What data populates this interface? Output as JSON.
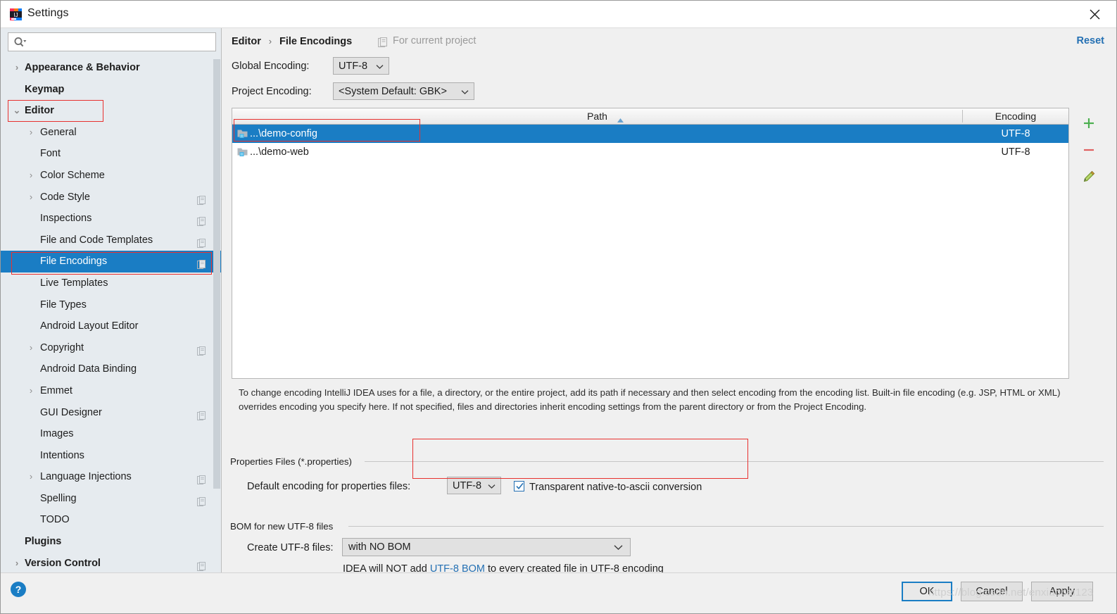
{
  "window": {
    "title": "Settings",
    "app_icon": "intellij-idea-icon",
    "close_icon": "close-icon"
  },
  "sidebar": {
    "search": {
      "placeholder": "",
      "value": "",
      "icon": "search-icon"
    },
    "items": [
      {
        "label": "Appearance & Behavior",
        "level": 0,
        "bold": true,
        "arrow": "›",
        "badge": false,
        "selected": false
      },
      {
        "label": "Keymap",
        "level": 0,
        "bold": true,
        "arrow": "",
        "badge": false,
        "selected": false
      },
      {
        "label": "Editor",
        "level": 0,
        "bold": true,
        "arrow": "⌄",
        "badge": false,
        "selected": false
      },
      {
        "label": "General",
        "level": 1,
        "bold": false,
        "arrow": "›",
        "badge": false,
        "selected": false
      },
      {
        "label": "Font",
        "level": 1,
        "bold": false,
        "arrow": "",
        "badge": false,
        "selected": false
      },
      {
        "label": "Color Scheme",
        "level": 1,
        "bold": false,
        "arrow": "›",
        "badge": false,
        "selected": false
      },
      {
        "label": "Code Style",
        "level": 1,
        "bold": false,
        "arrow": "›",
        "badge": true,
        "selected": false
      },
      {
        "label": "Inspections",
        "level": 1,
        "bold": false,
        "arrow": "",
        "badge": true,
        "selected": false
      },
      {
        "label": "File and Code Templates",
        "level": 1,
        "bold": false,
        "arrow": "",
        "badge": true,
        "selected": false
      },
      {
        "label": "File Encodings",
        "level": 1,
        "bold": false,
        "arrow": "",
        "badge": true,
        "selected": true
      },
      {
        "label": "Live Templates",
        "level": 1,
        "bold": false,
        "arrow": "",
        "badge": false,
        "selected": false
      },
      {
        "label": "File Types",
        "level": 1,
        "bold": false,
        "arrow": "",
        "badge": false,
        "selected": false
      },
      {
        "label": "Android Layout Editor",
        "level": 1,
        "bold": false,
        "arrow": "",
        "badge": false,
        "selected": false
      },
      {
        "label": "Copyright",
        "level": 1,
        "bold": false,
        "arrow": "›",
        "badge": true,
        "selected": false
      },
      {
        "label": "Android Data Binding",
        "level": 1,
        "bold": false,
        "arrow": "",
        "badge": false,
        "selected": false
      },
      {
        "label": "Emmet",
        "level": 1,
        "bold": false,
        "arrow": "›",
        "badge": false,
        "selected": false
      },
      {
        "label": "GUI Designer",
        "level": 1,
        "bold": false,
        "arrow": "",
        "badge": true,
        "selected": false
      },
      {
        "label": "Images",
        "level": 1,
        "bold": false,
        "arrow": "",
        "badge": false,
        "selected": false
      },
      {
        "label": "Intentions",
        "level": 1,
        "bold": false,
        "arrow": "",
        "badge": false,
        "selected": false
      },
      {
        "label": "Language Injections",
        "level": 1,
        "bold": false,
        "arrow": "›",
        "badge": true,
        "selected": false
      },
      {
        "label": "Spelling",
        "level": 1,
        "bold": false,
        "arrow": "",
        "badge": true,
        "selected": false
      },
      {
        "label": "TODO",
        "level": 1,
        "bold": false,
        "arrow": "",
        "badge": false,
        "selected": false
      },
      {
        "label": "Plugins",
        "level": 0,
        "bold": true,
        "arrow": "",
        "badge": false,
        "selected": false
      },
      {
        "label": "Version Control",
        "level": 0,
        "bold": true,
        "arrow": "›",
        "badge": true,
        "selected": false
      }
    ]
  },
  "main": {
    "breadcrumb": {
      "parent": "Editor",
      "separator": "›",
      "current": "File Encodings"
    },
    "scope_note": {
      "icon": "project-scope-icon",
      "text": "For current project"
    },
    "reset_label": "Reset",
    "global_encoding": {
      "label": "Global Encoding:",
      "value": "UTF-8"
    },
    "project_encoding": {
      "label": "Project Encoding:",
      "value": "<System Default: GBK>"
    },
    "table": {
      "columns": [
        {
          "key": "path",
          "label": "Path",
          "sort": "asc",
          "sort_icon": "sort-ascending-icon"
        },
        {
          "key": "encoding",
          "label": "Encoding",
          "sort": "none"
        }
      ],
      "rows": [
        {
          "icon": "module-folder-icon",
          "path": "...\\demo-config",
          "encoding": "UTF-8",
          "selected": true
        },
        {
          "icon": "module-folder-icon",
          "path": "...\\demo-web",
          "encoding": "UTF-8",
          "selected": false
        }
      ]
    },
    "table_buttons": [
      {
        "name": "add-button",
        "icon": "plus-icon",
        "color": "#4caf50"
      },
      {
        "name": "remove-button",
        "icon": "minus-icon",
        "color": "#e06060"
      },
      {
        "name": "edit-button",
        "icon": "pencil-icon",
        "color": "#8bc34a"
      }
    ],
    "help_text": "To change encoding IntelliJ IDEA uses for a file, a directory, or the entire project, add its path if necessary and then select encoding from the encoding list. Built-in file encoding (e.g. JSP, HTML or XML) overrides encoding you specify here. If not specified, files and directories inherit encoding settings from the parent directory or from the Project Encoding.",
    "properties_group": {
      "title": "Properties Files (*.properties)",
      "default_encoding_label": "Default encoding for properties files:",
      "default_encoding_value": "UTF-8",
      "transparent_checkbox_label": "Transparent native-to-ascii conversion",
      "transparent_checked": true
    },
    "bom_group": {
      "title": "BOM for new UTF-8 files",
      "create_label": "Create UTF-8 files:",
      "create_value": "with NO BOM",
      "note_prefix": "IDEA will NOT add ",
      "note_link": "UTF-8 BOM",
      "note_suffix": " to every created file in UTF-8 encoding"
    }
  },
  "footer": {
    "help_label": "?",
    "ok_label": "OK",
    "cancel_label": "Cancel",
    "apply_label": "Apply"
  },
  "watermark": "https://blog.csdn.net/enxiaobai123",
  "colors": {
    "selection": "#1a7dc4",
    "link": "#2470b3",
    "annotation": "#e8312f",
    "sidebar_bg": "#e6ebef",
    "panel_bg": "#f0f0f0"
  }
}
